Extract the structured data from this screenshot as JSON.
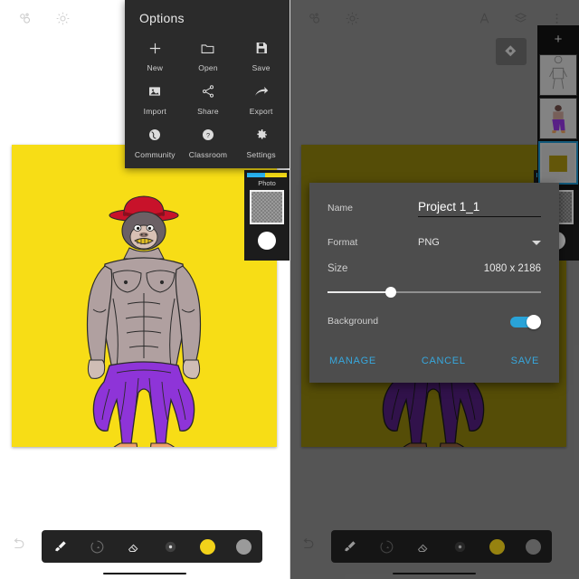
{
  "app": {
    "left_screen_title": "ArtFlow canvas with options menu",
    "right_screen_title": "ArtFlow canvas with export dialog"
  },
  "topbar": {
    "icons_left": [
      {
        "name": "bubbles-icon",
        "glyph": "⚘"
      },
      {
        "name": "gear-icon",
        "glyph": "⚙"
      }
    ],
    "icons_right": [
      {
        "name": "brush-tip-icon",
        "glyph": "A"
      },
      {
        "name": "layers-icon",
        "glyph": "☰"
      },
      {
        "name": "overflow-menu-icon",
        "glyph": "⋮"
      }
    ]
  },
  "options_menu": {
    "title": "Options",
    "items": [
      {
        "label": "New",
        "icon": "plus-icon"
      },
      {
        "label": "Open",
        "icon": "folder-icon"
      },
      {
        "label": "Save",
        "icon": "save-disk-icon"
      },
      {
        "label": "Import",
        "icon": "image-icon"
      },
      {
        "label": "Share",
        "icon": "share-icon"
      },
      {
        "label": "Export",
        "icon": "export-arrow-icon"
      },
      {
        "label": "Community",
        "icon": "globe-icon"
      },
      {
        "label": "Classroom",
        "icon": "question-circle-icon"
      },
      {
        "label": "Settings",
        "icon": "gear-icon"
      }
    ]
  },
  "photo_widget": {
    "label": "Photo"
  },
  "layers_panel": {
    "add_label": "+",
    "layers": [
      {
        "name": "layer-lineart",
        "selected": false
      },
      {
        "name": "layer-character",
        "selected": false
      },
      {
        "name": "layer-background",
        "selected": true
      }
    ]
  },
  "toolbar": {
    "tools": [
      {
        "name": "brush-tool",
        "icon": "brush-icon"
      },
      {
        "name": "smudge-tool",
        "icon": "smudge-icon"
      },
      {
        "name": "eraser-tool",
        "icon": "eraser-icon"
      },
      {
        "name": "size-tool",
        "icon": "dot-size-icon"
      },
      {
        "name": "primary-color-swatch",
        "icon": "circle-icon",
        "color": "#f2d21a"
      },
      {
        "name": "secondary-color-swatch",
        "icon": "circle-icon",
        "color": "#9a9a9a"
      }
    ],
    "undo_icon": "undo-arrow-icon"
  },
  "export_dialog": {
    "fields": {
      "name_label": "Name",
      "name_value": "Project 1_1",
      "format_label": "Format",
      "format_value": "PNG",
      "size_label": "Size",
      "size_value": "1080 x 2186",
      "background_label": "Background",
      "background_on": true
    },
    "buttons": {
      "manage": "MANAGE",
      "cancel": "CANCEL",
      "save": "SAVE"
    }
  },
  "colors": {
    "canvas_yellow": "#f7dd16",
    "accent_blue": "#37a8de",
    "toggle_blue": "#29a3d8",
    "menu_dark": "#2b2b2b",
    "dialog_gray": "#4d4d4d",
    "pants_purple": "#8e34d8",
    "hat_red": "#c8122a",
    "shoe_orange": "#f0a06a",
    "skin_gray": "#b0a0a0"
  }
}
